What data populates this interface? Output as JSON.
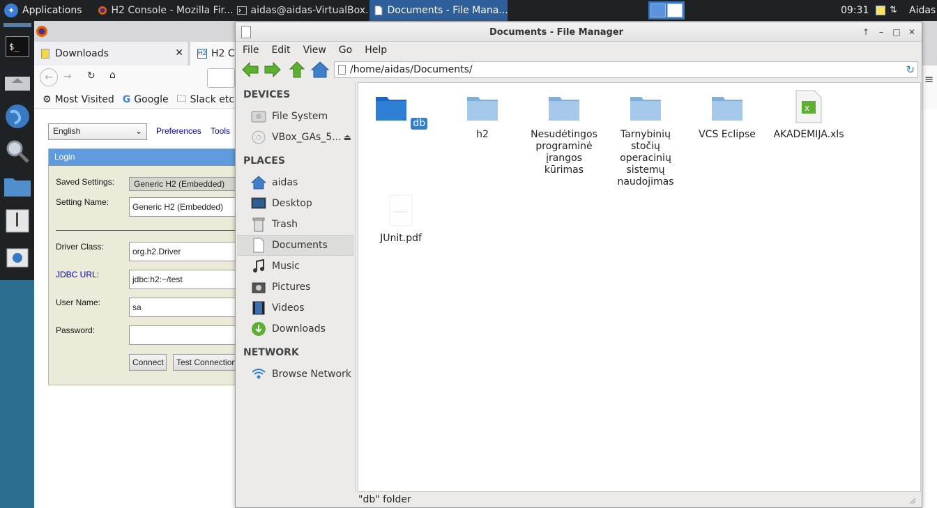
{
  "panel": {
    "applications_label": "Applications",
    "tasks": [
      {
        "label": "H2 Console - Mozilla Fir..."
      },
      {
        "label": "aidas@aidas-VirtualBox..."
      },
      {
        "label": "Documents - File Mana..."
      }
    ],
    "clock": "09:31",
    "user": "Aidas"
  },
  "firefox": {
    "tabs": [
      {
        "label": "Downloads"
      },
      {
        "label": "H2 C"
      }
    ],
    "bookmarks": [
      {
        "label": "Most Visited"
      },
      {
        "label": "Google"
      },
      {
        "label": "Slack etc."
      }
    ],
    "h2": {
      "language": "English",
      "links": {
        "preferences": "Preferences",
        "tools": "Tools"
      },
      "login_header": "Login",
      "saved_settings_label": "Saved Settings:",
      "saved_settings_value": "Generic H2 (Embedded)",
      "setting_name_label": "Setting Name:",
      "setting_name_value": "Generic H2 (Embedded)",
      "driver_class_label": "Driver Class:",
      "driver_class_value": "org.h2.Driver",
      "jdbc_url_label": "JDBC URL",
      "jdbc_url_value": "jdbc:h2:~/test",
      "user_name_label": "User Name:",
      "user_name_value": "sa",
      "password_label": "Password:",
      "connect_label": "Connect",
      "test_connection_label": "Test Connection"
    }
  },
  "file_manager": {
    "title": "Documents - File Manager",
    "menu": [
      "File",
      "Edit",
      "View",
      "Go",
      "Help"
    ],
    "location": "/home/aidas/Documents/",
    "sidebar": {
      "devices_heading": "DEVICES",
      "devices": [
        {
          "label": "File System",
          "icon": "hard-drive-icon"
        },
        {
          "label": "VBox_GAs_5...",
          "icon": "cdrom-icon"
        }
      ],
      "places_heading": "PLACES",
      "places": [
        {
          "label": "aidas",
          "icon": "home-icon"
        },
        {
          "label": "Desktop",
          "icon": "desktop-icon"
        },
        {
          "label": "Trash",
          "icon": "trash-icon"
        },
        {
          "label": "Documents",
          "icon": "document-icon"
        },
        {
          "label": "Music",
          "icon": "music-icon"
        },
        {
          "label": "Pictures",
          "icon": "pictures-icon"
        },
        {
          "label": "Videos",
          "icon": "videos-icon"
        },
        {
          "label": "Downloads",
          "icon": "downloads-icon"
        }
      ],
      "network_heading": "NETWORK",
      "network": [
        {
          "label": "Browse Network",
          "icon": "network-icon"
        }
      ]
    },
    "files": [
      {
        "name": "db",
        "type": "folder",
        "selected": true
      },
      {
        "name": "h2",
        "type": "folder"
      },
      {
        "name": "Nesudėtingos programinė įrangos kūrimas",
        "type": "folder"
      },
      {
        "name": "Tarnybinių stočių operacinių sistemų naudojimas",
        "type": "folder"
      },
      {
        "name": "VCS Eclipse",
        "type": "folder"
      },
      {
        "name": "AKADEMIJA.xls",
        "type": "spreadsheet"
      },
      {
        "name": "JUnit.pdf",
        "type": "pdf"
      }
    ],
    "status": "\"db\" folder"
  }
}
